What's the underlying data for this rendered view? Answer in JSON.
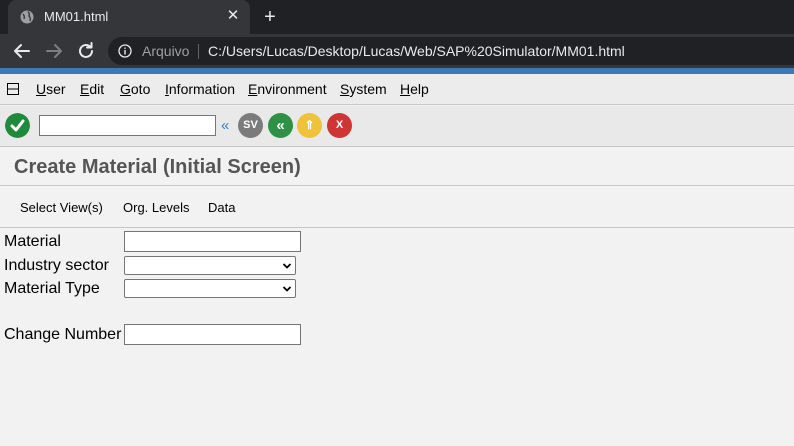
{
  "browser": {
    "tab_title": "MM01.html",
    "tab_close": "✕",
    "new_tab": "+",
    "address_scheme_label": "Arquivo",
    "address_url": "C:/Users/Lucas/Desktop/Lucas/Web/SAP%20Simulator/MM01.html"
  },
  "menubar": {
    "items": [
      {
        "first": "U",
        "rest": "ser"
      },
      {
        "first": "E",
        "rest": "dit"
      },
      {
        "first": "G",
        "rest": "oto"
      },
      {
        "first": "I",
        "rest": "nformation"
      },
      {
        "first": "E",
        "rest": "nvironment"
      },
      {
        "first": "S",
        "rest": "ystem"
      },
      {
        "first": "H",
        "rest": "elp"
      }
    ]
  },
  "sap_toolbar": {
    "command_value": "",
    "back_label": "«",
    "save_label": "SV",
    "back_button_label": "«",
    "exit_label": "⇑",
    "cancel_label": "X",
    "colors": {
      "enter": "#1e8a3c",
      "save": "#7b7b7b",
      "back": "#2e9146",
      "exit": "#f0c23a",
      "cancel": "#d03535"
    }
  },
  "page": {
    "title": "Create Material (Initial Screen)"
  },
  "app_toolbar": {
    "select_views": "Select View(s)",
    "org_levels": "Org. Levels",
    "data": "Data"
  },
  "form": {
    "material_label": "Material",
    "material_value": "",
    "industry_sector_label": "Industry sector",
    "industry_sector_value": "",
    "material_type_label": "Material Type",
    "material_type_value": "",
    "change_number_label": "Change Number",
    "change_number_value": ""
  }
}
